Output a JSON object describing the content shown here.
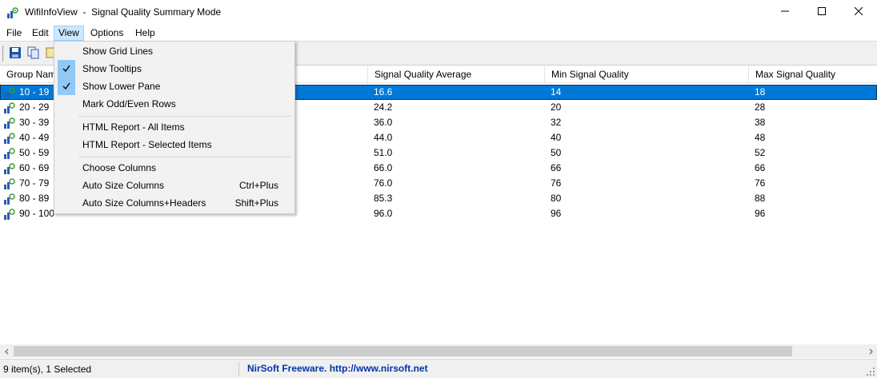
{
  "window": {
    "title": "WifiInfoView  -  Signal Quality Summary Mode",
    "minimize_icon": "minimize-icon",
    "maximize_icon": "maximize-icon",
    "close_icon": "close-icon"
  },
  "menubar": {
    "items": [
      {
        "label": "File"
      },
      {
        "label": "Edit"
      },
      {
        "label": "View"
      },
      {
        "label": "Options"
      },
      {
        "label": "Help"
      }
    ]
  },
  "toolbar": {
    "buttons": [
      {
        "icon": "save-icon"
      },
      {
        "icon": "copy-icon"
      },
      {
        "icon": "html-report-icon"
      }
    ]
  },
  "table": {
    "columns": [
      {
        "label": "Group Name"
      },
      {
        "label": ""
      },
      {
        "label": ""
      },
      {
        "label": "Signal Quality Average"
      },
      {
        "label": "Min Signal Quality"
      },
      {
        "label": "Max Signal Quality"
      }
    ],
    "rows": [
      {
        "group": "10  -  19",
        "avg": "16.6",
        "min": "14",
        "max": "18",
        "selected": true
      },
      {
        "group": "20  -  29",
        "avg": "24.2",
        "min": "20",
        "max": "28"
      },
      {
        "group": "30  -  39",
        "avg": "36.0",
        "min": "32",
        "max": "38"
      },
      {
        "group": "40  -  49",
        "avg": "44.0",
        "min": "40",
        "max": "48"
      },
      {
        "group": "50  -  59",
        "avg": "51.0",
        "min": "50",
        "max": "52"
      },
      {
        "group": "60  -  69",
        "avg": "66.0",
        "min": "66",
        "max": "66"
      },
      {
        "group": "70  -  79",
        "avg": "76.0",
        "min": "76",
        "max": "76"
      },
      {
        "group": "80  -  89",
        "avg": "85.3",
        "min": "80",
        "max": "88"
      },
      {
        "group": "90  -  100",
        "avg": "96.0",
        "min": "96",
        "max": "96"
      }
    ],
    "row_icon": "wifi-signal-icon"
  },
  "view_menu": {
    "items": [
      {
        "label": "Show Grid Lines",
        "checked": false,
        "shortcut": ""
      },
      {
        "label": "Show Tooltips",
        "checked": true,
        "shortcut": ""
      },
      {
        "label": "Show Lower Pane",
        "checked": true,
        "shortcut": ""
      },
      {
        "label": "Mark Odd/Even Rows",
        "checked": false,
        "shortcut": ""
      },
      {
        "label": "HTML Report - All Items",
        "checked": false,
        "shortcut": ""
      },
      {
        "label": "HTML Report - Selected Items",
        "checked": false,
        "shortcut": ""
      },
      {
        "label": "Choose Columns",
        "checked": false,
        "shortcut": ""
      },
      {
        "label": "Auto Size Columns",
        "checked": false,
        "shortcut": "Ctrl+Plus"
      },
      {
        "label": "Auto Size Columns+Headers",
        "checked": false,
        "shortcut": "Shift+Plus"
      }
    ],
    "check_icon": "checkmark-icon"
  },
  "statusbar": {
    "items_text": "9 item(s), 1 Selected",
    "link_text": "NirSoft Freeware.  http://www.nirsoft.net"
  },
  "colors": {
    "selection": "#0078d7",
    "menu_open": "#cce8ff",
    "check_bg": "#90c8f6",
    "link": "#0033aa"
  }
}
